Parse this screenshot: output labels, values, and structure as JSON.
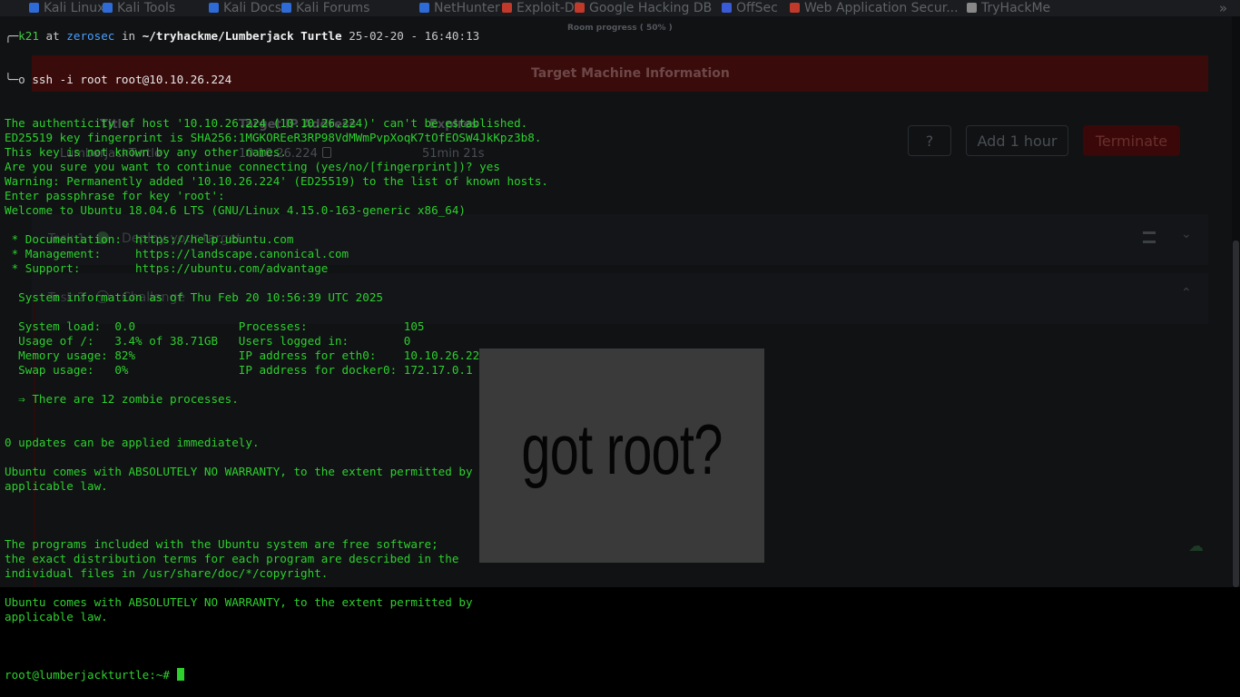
{
  "browser": {
    "bookmarks": [
      {
        "label": "Kali Linux",
        "color": "#2e6bd6"
      },
      {
        "label": "Kali Tools",
        "color": "#2e6bd6"
      },
      {
        "label": "Kali Docs",
        "color": "#2e6bd6"
      },
      {
        "label": "Kali Forums",
        "color": "#2e6bd6"
      },
      {
        "label": "NetHunter",
        "color": "#2e6bd6"
      },
      {
        "label": "Exploit-DB",
        "color": "#c0392b"
      },
      {
        "label": "Google Hacking DB",
        "color": "#c0392b"
      },
      {
        "label": "OffSec",
        "color": "#3a5bd6"
      },
      {
        "label": "Web Application Secur...",
        "color": "#c0392b"
      },
      {
        "label": "TryHackMe",
        "color": "#888888"
      }
    ],
    "more_icon": "chevron-double-right-icon",
    "room_progress": "Room progress ( 50% )",
    "target_info": {
      "title": "Target Machine Information",
      "title_col": "Title",
      "ip_col": "Target IP Address",
      "expires_col": "Expires",
      "title_val": "LumberjackTurtle",
      "ip_val": "10.10.26.224",
      "expires_val": "51min 21s",
      "help_btn": "?",
      "add_hour_btn": "Add 1 hour",
      "terminate_btn": "Terminate"
    },
    "tasks": [
      {
        "num": "Task 1",
        "title": "Deploy your target",
        "done": true
      },
      {
        "num": "Task 2",
        "title": "Challenge",
        "done": false
      }
    ],
    "colors": {
      "accent_red": "#c81e1e",
      "thm_green": "#3fa34d"
    }
  },
  "terminal": {
    "prompt": {
      "user": "k21",
      "at": "at",
      "host": "zerosec",
      "in": "in",
      "path": "~/tryhackme/Lumberjack Turtle",
      "datetime": "25-02-20 - 16:40:13",
      "corner_top": "╭─",
      "corner_bottom": "╰─o",
      "command": "ssh -i root root@10.10.26.224"
    },
    "lines": [
      "The authenticity of host '10.10.26.224 (10.10.26.224)' can't be established.",
      "ED25519 key fingerprint is SHA256:1MGKOREeR3RP98VdMWmPvpXoqK7tOfEOSW4JkKpz3b8.",
      "This key is not known by any other names.",
      "Are you sure you want to continue connecting (yes/no/[fingerprint])? yes",
      "Warning: Permanently added '10.10.26.224' (ED25519) to the list of known hosts.",
      "Enter passphrase for key 'root':",
      "Welcome to Ubuntu 18.04.6 LTS (GNU/Linux 4.15.0-163-generic x86_64)",
      "",
      " * Documentation:  https://help.ubuntu.com",
      " * Management:     https://landscape.canonical.com",
      " * Support:        https://ubuntu.com/advantage",
      "",
      "  System information as of Thu Feb 20 10:56:39 UTC 2025",
      "",
      "  System load:  0.0               Processes:              105",
      "  Usage of /:   3.4% of 38.71GB   Users logged in:        0",
      "  Memory usage: 82%               IP address for eth0:    10.10.26.224",
      "  Swap usage:   0%                IP address for docker0: 172.17.0.1",
      "",
      "  ⇒ There are 12 zombie processes.",
      "",
      "",
      "0 updates can be applied immediately.",
      "",
      "Ubuntu comes with ABSOLUTELY NO WARRANTY, to the extent permitted by",
      "applicable law.",
      "",
      "",
      "",
      "The programs included with the Ubuntu system are free software;",
      "the exact distribution terms for each program are described in the",
      "individual files in /usr/share/doc/*/copyright.",
      "",
      "Ubuntu comes with ABSOLUTELY NO WARRANTY, to the extent permitted by",
      "applicable law.",
      ""
    ],
    "final_prompt": "root@lumberjackturtle:~# "
  },
  "overlay_image": {
    "text": "got root?",
    "bg_color": "#3a3a3a"
  }
}
